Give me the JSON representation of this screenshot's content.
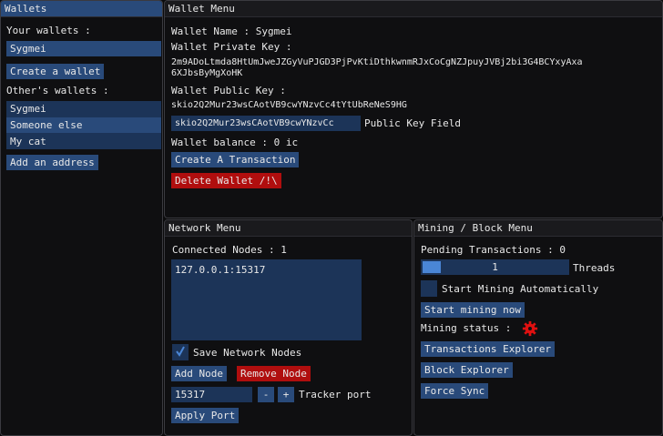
{
  "wallets": {
    "title": "Wallets",
    "your_label": "Your wallets :",
    "your_items": [
      "Sygmei"
    ],
    "create_label": "Create a wallet",
    "others_label": "Other's wallets :",
    "others_items": [
      "Sygmei",
      "Someone else",
      "My cat"
    ],
    "add_label": "Add an address"
  },
  "wallet_menu": {
    "title": "Wallet Menu",
    "name_line": "Wallet Name : Sygmei",
    "private_label": "Wallet Private Key :",
    "private_key_1": "2m9ADoLtmda8HtUmJweJZGyVuPJGD3PjPvKtiDthkwnmRJxCoCgNZJpuyJVBj2bi3G4BCYxyAxa",
    "private_key_2": "6XJbsByMgXoHK",
    "public_label": "Wallet Public Key :",
    "public_key": "skio2Q2Mur23wsCAotVB9cwYNzvCc4tYtUbReNeS9HG",
    "public_field_value": "skio2Q2Mur23wsCAotVB9cwYNzvCc",
    "public_field_label": "Public Key Field",
    "balance_line": "Wallet balance : 0 ic",
    "create_tx_label": "Create A Transaction",
    "delete_label": "Delete Wallet /!\\"
  },
  "network": {
    "title": "Network Menu",
    "connected_line": "Connected Nodes : 1",
    "nodes": [
      "127.0.0.1:15317"
    ],
    "save_label": "Save Network Nodes",
    "save_checked": true,
    "add_node_label": "Add Node",
    "remove_node_label": "Remove Node",
    "port_value": "15317",
    "minus_label": "-",
    "plus_label": "+",
    "tracker_label": "Tracker port",
    "apply_label": "Apply Port"
  },
  "mining": {
    "title": "Mining / Block Menu",
    "pending_line": "Pending Transactions : 0",
    "threads_value": "1",
    "threads_fraction": 0.12,
    "threads_label": "Threads",
    "auto_label": "Start Mining Automatically",
    "auto_checked": false,
    "start_label": "Start mining now",
    "status_label": "Mining status :",
    "status_icon": "gear-icon",
    "status_color": "#e01010",
    "tx_explorer_label": "Transactions Explorer",
    "block_explorer_label": "Block Explorer",
    "force_sync_label": "Force Sync"
  },
  "colors": {
    "accent": "#294a7a",
    "danger": "#b00e0e",
    "progress_fill": "#4a86d6"
  }
}
